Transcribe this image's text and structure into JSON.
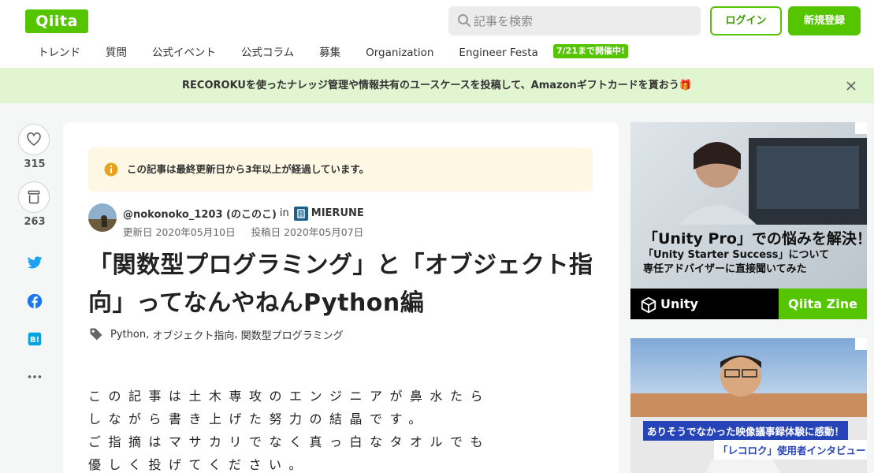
{
  "header": {
    "logo": "Qiita",
    "search_placeholder": "記事を検索",
    "login_label": "ログイン",
    "signup_label": "新規登録",
    "nav": [
      "トレンド",
      "質問",
      "公式イベント",
      "公式コラム",
      "募集",
      "Organization",
      "Engineer Festa"
    ],
    "nav_badge": "7/21まで開催中!",
    "brand_color": "#55c500"
  },
  "banner": {
    "text": "RECOROKUを使ったナレッジ管理や情報共有のユースケースを投稿して、Amazonギフトカードを貰おう🎁"
  },
  "actions": {
    "like_count": "315",
    "stock_count": "263",
    "icons": [
      "heart-icon",
      "stock-icon",
      "twitter-icon",
      "facebook-icon",
      "hatena-bookmark-icon",
      "more-icon"
    ]
  },
  "article": {
    "notice": "この記事は最終更新日から3年以上が経過しています。",
    "author": "@nokonoko_1203 (のこのこ)",
    "in_label": "in",
    "organization": "MIERUNE",
    "updated": "更新日 2020年05月10日",
    "posted": "投稿日 2020年05月07日",
    "title": "「関数型プログラミング」と「オブジェクト指向」ってなんやねんPython編",
    "tags": [
      "Python",
      "オブジェクト指向",
      "関数型プログラミング"
    ],
    "body_lines": [
      "この記事は土木専攻のエンジニアが鼻水たら",
      "しながら書き上げた努力の結晶です。",
      "ご指摘はマサカリでなく真っ白なタオルでも",
      "優しく投げてください。"
    ]
  },
  "ads": {
    "ad1": {
      "headline": "「Unity Pro」での悩みを解決！",
      "sub1": "「Unity Starter Success」について",
      "sub2": "専任アドバイザーに直接聞いてみた",
      "brand": "Unity",
      "zine": "Qiita Zine"
    },
    "ad2": {
      "line1": "ありそうでなかった映像議事録体験に感動！",
      "line2": "「レコロク」使用者インタビュー"
    }
  }
}
